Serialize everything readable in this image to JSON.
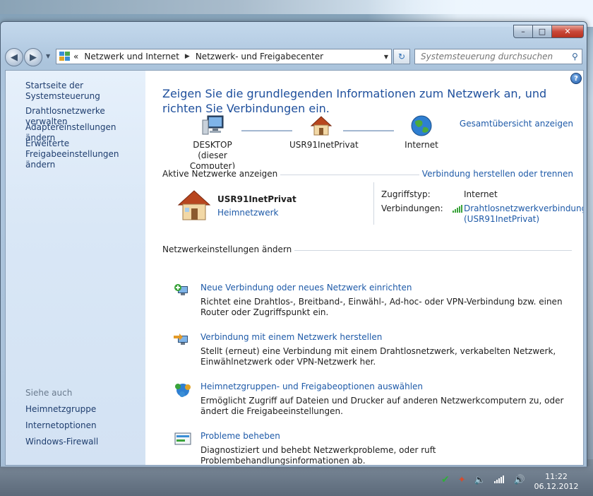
{
  "window": {
    "address_segments": [
      "Netzwerk und Internet",
      "Netzwerk- und Freigabecenter"
    ],
    "address_prefix": "«",
    "search_placeholder": "Systemsteuerung durchsuchen",
    "caption": {
      "minimize": "–",
      "maximize": "□",
      "close": "✕"
    }
  },
  "sidebar": {
    "home": "Startseite der Systemsteuerung",
    "items": [
      "Drahtlosnetzwerke verwalten",
      "Adaptereinstellungen ändern",
      "Erweiterte",
      "Freigabeeinstellungen ändern"
    ],
    "see_also_header": "Siehe auch",
    "see_also": [
      "Heimnetzgruppe",
      "Internetoptionen",
      "Windows-Firewall"
    ]
  },
  "main": {
    "title": "Zeigen Sie die grundlegenden Informationen zum Netzwerk an, und richten Sie Verbindungen ein.",
    "overview_link": "Gesamtübersicht anzeigen",
    "map": {
      "computer": [
        "DESKTOP",
        "(dieser Computer)"
      ],
      "network": "USR91InetPrivat",
      "internet": "Internet"
    },
    "active_networks": {
      "title": "Aktive Netzwerke anzeigen",
      "connect_link": "Verbindung herstellen oder trennen",
      "name": "USR91InetPrivat",
      "type": "Heimnetzwerk",
      "access_label": "Zugriffstyp:",
      "access_value": "Internet",
      "connections_label": "Verbindungen:",
      "connection_value": [
        "Drahtlosnetzwerkverbindung",
        "(USR91InetPrivat)"
      ]
    },
    "settings": {
      "title": "Netzwerkeinstellungen ändern",
      "tasks": [
        {
          "title": "Neue Verbindung oder neues Netzwerk einrichten",
          "desc": "Richtet eine Drahtlos-, Breitband-, Einwähl-, Ad-hoc- oder VPN-Verbindung bzw. einen Router oder Zugriffspunkt ein."
        },
        {
          "title": "Verbindung mit einem Netzwerk herstellen",
          "desc": "Stellt (erneut) eine Verbindung mit einem Drahtlosnetzwerk, verkabelten Netzwerk, Einwählnetzwerk oder VPN-Netzwerk her."
        },
        {
          "title": "Heimnetzgruppen- und Freigabeoptionen auswählen",
          "desc": "Ermöglicht Zugriff auf Dateien und Drucker auf anderen Netzwerkcomputern zu, oder ändert die Freigabeeinstellungen."
        },
        {
          "title": "Probleme beheben",
          "desc": "Diagnostiziert und behebt Netzwerkprobleme, oder ruft Problembehandlungsinformationen ab."
        }
      ]
    }
  },
  "taskbar": {
    "time": "11:22",
    "date": "06.12.2012"
  },
  "colors": {
    "link": "#1e5aa8",
    "title": "#1e4f9c"
  }
}
